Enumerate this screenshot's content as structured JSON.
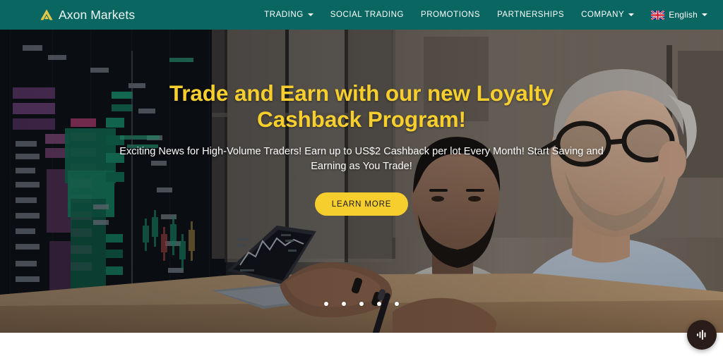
{
  "header": {
    "brand": {
      "logo_icon": "axon-triangle-logo",
      "name": "Axon Markets"
    },
    "nav_items": [
      {
        "label": "TRADING",
        "has_dropdown": true
      },
      {
        "label": "SOCIAL TRADING",
        "has_dropdown": false
      },
      {
        "label": "PROMOTIONS",
        "has_dropdown": false
      },
      {
        "label": "PARTNERSHIPS",
        "has_dropdown": false
      },
      {
        "label": "COMPANY",
        "has_dropdown": true
      }
    ],
    "language": {
      "label": "English",
      "flag_icon": "uk-flag-icon",
      "has_dropdown": true
    },
    "background_color": "#0a6661"
  },
  "hero": {
    "title": "Trade and Earn with our new Loyalty Cashback Program!",
    "subtitle": "Exciting News for High-Volume Traders! Earn up to US$2 Cashback per lot Every Month! Start Saving and Earning as You Trade!",
    "cta_label": "LEARN MORE",
    "title_color": "#F6CF2E",
    "cta_color": "#F6CF2E",
    "carousel": {
      "total_slides": 5,
      "active_slide": 1
    },
    "image_description": "Two businessmen at a desk reviewing a laptop showing a trading chart, with a large dark trading terminal display on the left"
  },
  "floating_widget": {
    "icon": "sound-waveform-icon",
    "background_color": "#2a1c19"
  }
}
